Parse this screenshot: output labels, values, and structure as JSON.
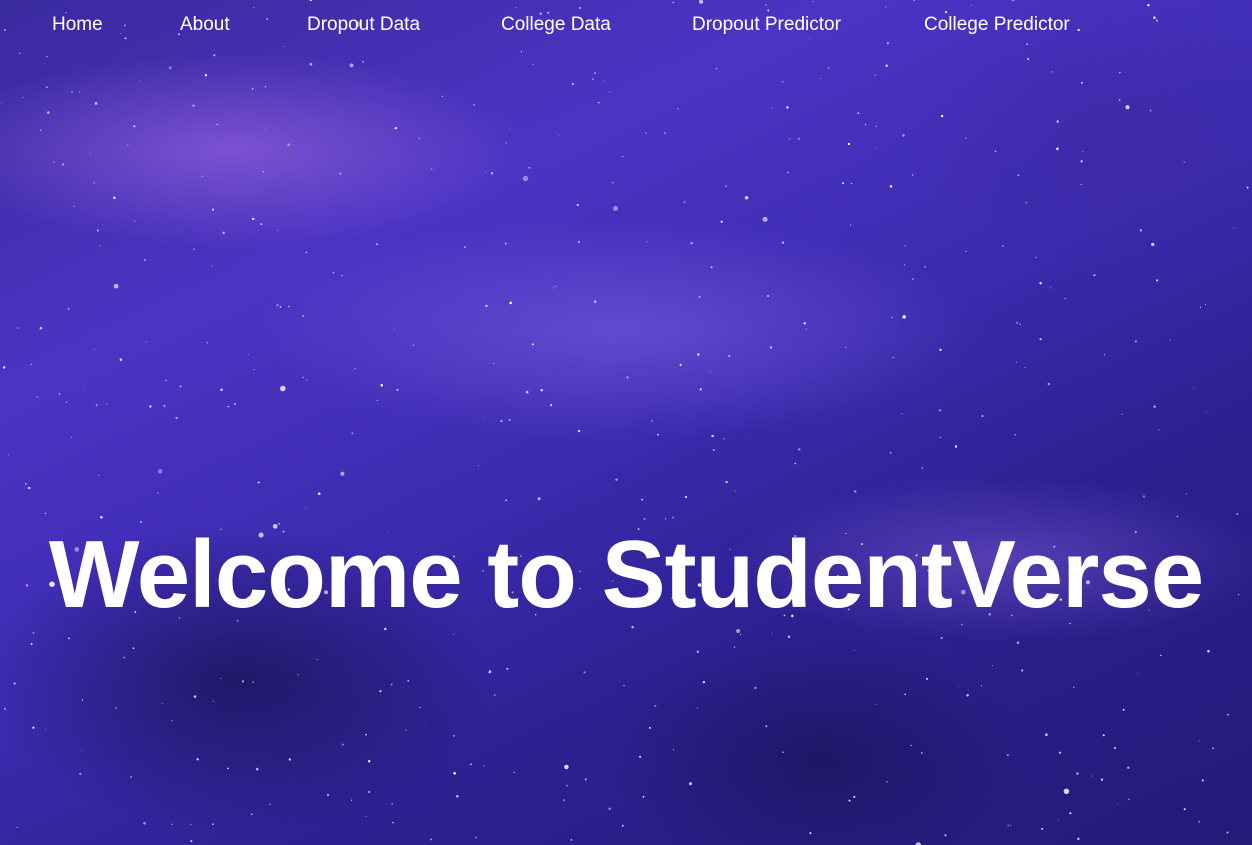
{
  "nav": {
    "home": "Home",
    "about": "About",
    "dropout_data": "Dropout Data",
    "college_data": "College Data",
    "dropout_predictor": "Dropout Predictor",
    "college_predictor": "College Predictor"
  },
  "hero": {
    "title": "Welcome to StudentVerse"
  },
  "background": {
    "image": "starry-galaxy-nebula",
    "colors": [
      "#3a2a9e",
      "#4b34c4",
      "#241a78",
      "#aa6ee6"
    ]
  }
}
